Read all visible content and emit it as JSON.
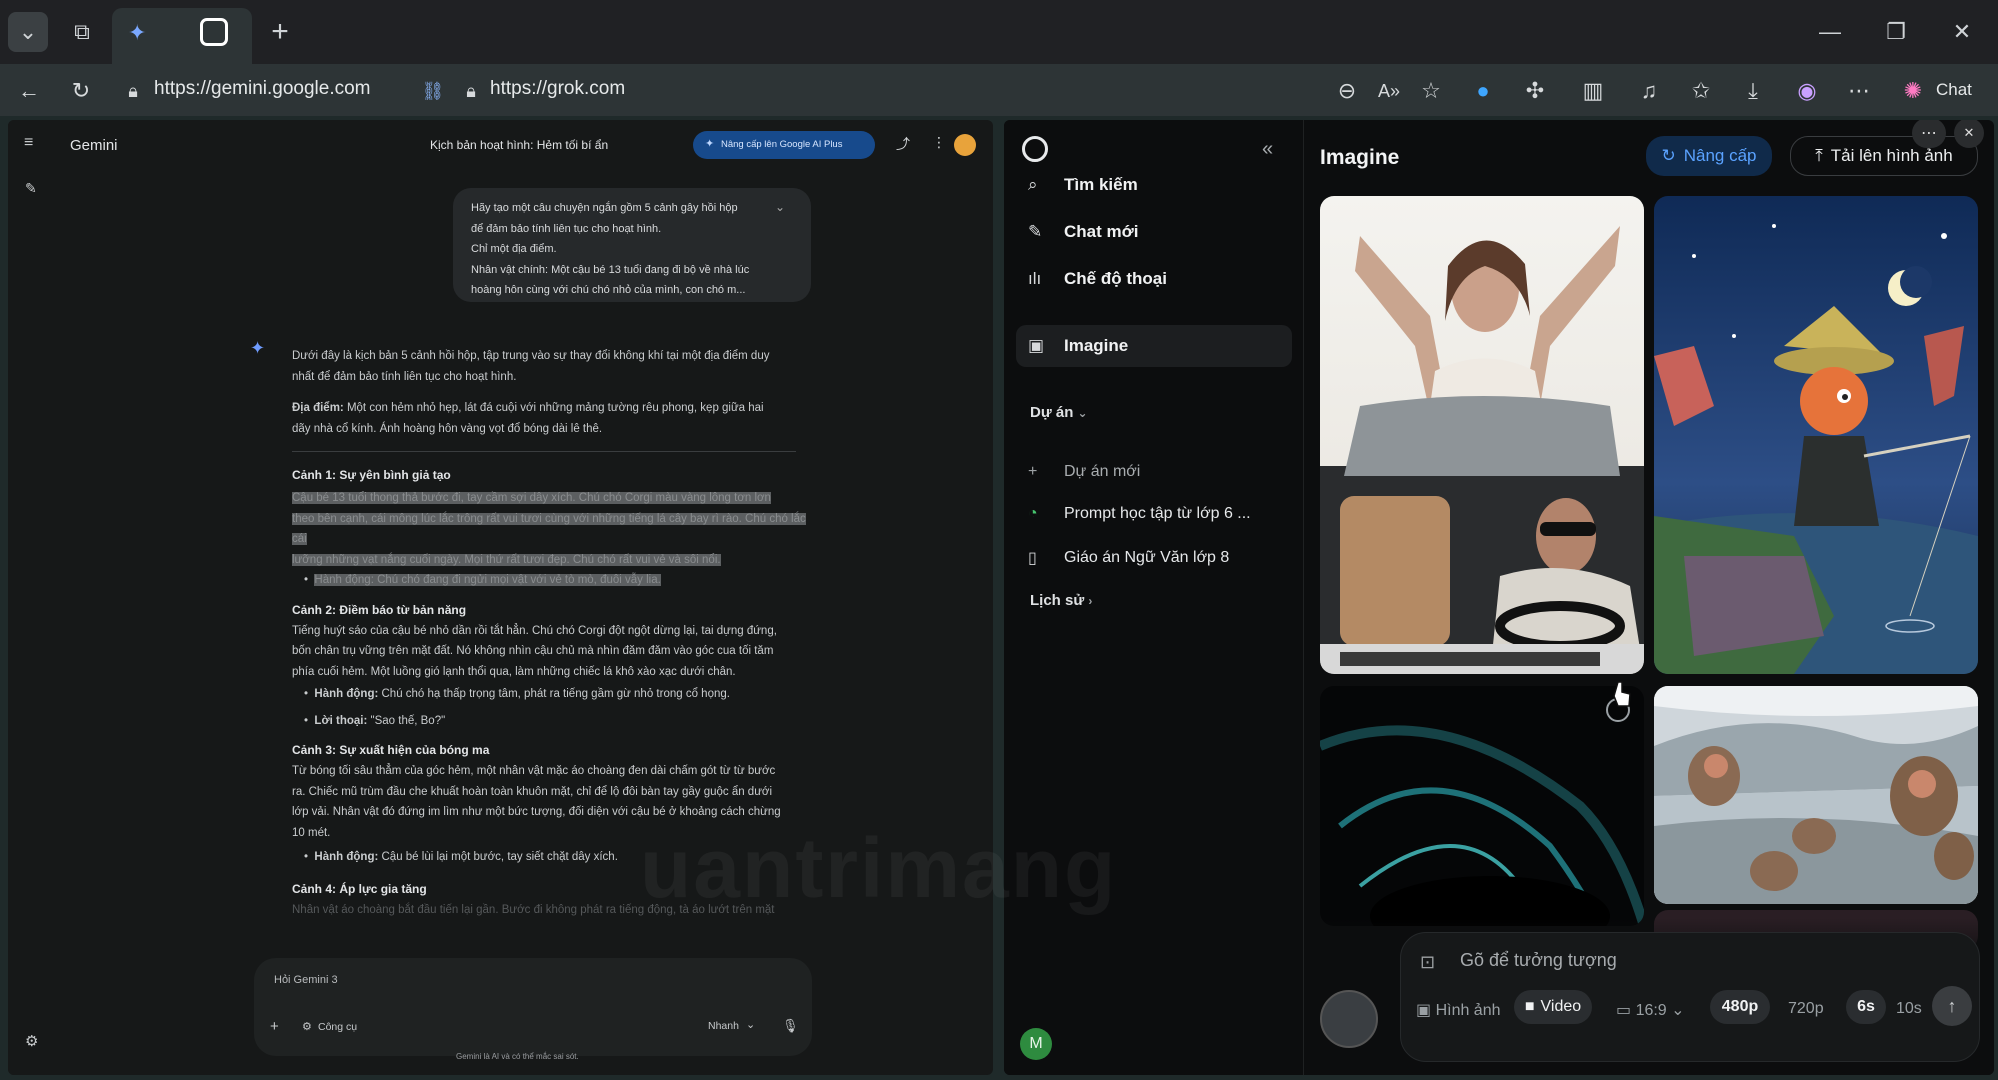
{
  "browser": {
    "url_left": "https://gemini.google.com",
    "url_right": "https://grok.com",
    "copilot_label": "Chat",
    "colors": {
      "tabbar": "#202124",
      "toolbar": "#2d3436"
    }
  },
  "gemini": {
    "brand": "Gemini",
    "conversation_title": "Kịch bản hoạt hình: Hẻm tối bí ẩn",
    "upgrade_label": "Nâng cấp lên Google AI Plus",
    "user_message": [
      "Hãy tạo một câu chuyện ngắn gồm 5 cảnh gây hồi hộp",
      "để đảm bảo tính liên tục cho hoạt hình.",
      "Chỉ một địa điểm.",
      "Nhân vật chính: Một cậu bé 13 tuổi đang đi bộ về nhà lúc",
      "hoàng hôn cùng với chú chó nhỏ của mình, con chó m..."
    ],
    "response": {
      "intro": [
        "Dưới đây là kịch bản 5 cảnh hồi hộp, tập trung vào sự thay đổi không khí tại một địa điểm duy",
        "nhất để đảm bảo tính liên tục cho hoạt hình."
      ],
      "location_label": "Địa điểm:",
      "location_text": [
        " Một con hẻm nhỏ hẹp, lát đá cuội với những mảng tường rêu phong, kẹp giữa hai",
        "dãy nhà cổ kính. Ánh hoàng hôn vàng vọt đổ bóng dài lê thê."
      ],
      "scene1_title": "Cảnh 1: Sự yên bình giả tạo",
      "scene1_hl": [
        "Cậu bé 13 tuổi thong thả bước đi, tay cầm sợi dây xích. Chú chó Corgi màu vàng lông tơn lơn",
        "theo bên cạnh, cái mông lúc lắc trông rất vui tươi cùng với những tiếng lá cây bay rì rào. Chú chó lắc cái",
        "lưỡng những vạt nắng cuối ngày. Mọi thứ rất tươi đẹp. Chú chó rất vui vẻ và sôi nổi."
      ],
      "scene1_action": "Hành động: Chú chó đang đi ngửi mọi vật với vẻ tò mò, đuôi vẫy lia.",
      "scene2_title": "Cảnh 2: Điềm báo từ bản năng",
      "scene2_text": [
        "Tiếng huýt sáo của cậu bé nhỏ dần rồi tắt hẳn. Chú chó Corgi đột ngột dừng lại, tai dựng đứng,",
        "bốn chân trụ vững trên mặt đất. Nó không nhìn cậu chủ mà nhìn đăm đăm vào góc cua tối tăm",
        "phía cuối hẻm. Một luồng gió lạnh thổi qua, làm những chiếc lá khô xào xạc dưới chân."
      ],
      "scene2_action_label": "Hành động:",
      "scene2_action": " Chú chó hạ thấp trọng tâm, phát ra tiếng gầm gừ nhỏ trong cổ họng.",
      "scene2_dialog_label": "Lời thoại:",
      "scene2_dialog": " \"Sao thế, Bo?\"",
      "scene3_title": "Cảnh 3: Sự xuất hiện của bóng ma",
      "scene3_text": [
        "Từ bóng tối sâu thẳm của góc hẻm, một nhân vật mặc áo choàng đen dài chấm gót từ từ bước",
        "ra. Chiếc mũ trùm đầu che khuất hoàn toàn khuôn mặt, chỉ để lộ đôi bàn tay gầy guộc ẩn dưới",
        "lớp vải. Nhân vật đó đứng im lìm như một bức tượng, đối diện với cậu bé ở khoảng cách chừng",
        "10 mét."
      ],
      "scene3_action_label": "Hành động:",
      "scene3_action": " Cậu bé lùi lại một bước, tay siết chặt dây xích.",
      "scene4_title": "Cảnh 4: Áp lực gia tăng",
      "scene4_fade": "Nhân vật áo choàng bắt đầu tiến lại gần. Bước đi không phát ra tiếng động, tà áo lướt trên mặt"
    },
    "input_placeholder": "Hỏi Gemini 3",
    "tools_label": "Công cụ",
    "mode_label": "Nhanh",
    "disclaimer": "Gemini là AI và có thể mắc sai sót."
  },
  "grok": {
    "nav": [
      {
        "icon": "search-icon",
        "label": "Tìm kiếm"
      },
      {
        "icon": "edit-icon",
        "label": "Chat mới"
      },
      {
        "icon": "voice-icon",
        "label": "Chế độ thoại"
      },
      {
        "icon": "image-icon",
        "label": "Imagine"
      }
    ],
    "projects_label": "Dự án",
    "new_project": "Dự án mới",
    "projects": [
      "Prompt học tập từ lớp 6 ...",
      "Giáo án Ngữ Văn lớp 8"
    ],
    "history_label": "Lịch sử",
    "avatar_initial": "M",
    "page_title": "Imagine",
    "upgrade_label": "Nâng cấp",
    "upload_label": "Tải lên hình ảnh",
    "prompt_placeholder": "Gõ để tưởng tượng",
    "options": {
      "image": "Hình ảnh",
      "video": "Video",
      "ratio": "16:9",
      "res_480": "480p",
      "res_720": "720p",
      "dur_6": "6s",
      "dur_10": "10s"
    },
    "accent": "#1d6ef0"
  },
  "watermark": "uantrimang"
}
